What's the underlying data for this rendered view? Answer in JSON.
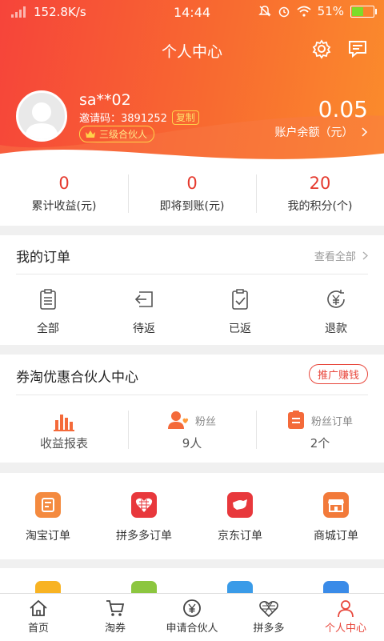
{
  "status_bar": {
    "network_speed": "152.8K/s",
    "time": "14:44",
    "battery": "51%"
  },
  "header": {
    "title": "个人中心"
  },
  "profile": {
    "username": "sa**02",
    "invite_label": "邀请码：3891252",
    "copy_label": "复制",
    "level": "三级合伙人",
    "balance": "0.05",
    "balance_label": "账户余额（元）"
  },
  "stats": [
    {
      "value": "0",
      "label": "累计收益(元)"
    },
    {
      "value": "0",
      "label": "即将到账(元)"
    },
    {
      "value": "20",
      "label": "我的积分(个)"
    }
  ],
  "orders": {
    "title": "我的订单",
    "view_all": "查看全部",
    "items": [
      {
        "label": "全部",
        "icon": "clipboard-list-icon"
      },
      {
        "label": "待返",
        "icon": "return-icon"
      },
      {
        "label": "已返",
        "icon": "clipboard-check-icon"
      },
      {
        "label": "退款",
        "icon": "yen-refund-icon"
      }
    ]
  },
  "partner": {
    "title": "券淘优惠合伙人中心",
    "promo_button": "推广赚钱",
    "report_label": "收益报表",
    "fans_label": "粉丝",
    "fans_count": "9人",
    "fan_orders_label": "粉丝订单",
    "fan_orders_count": "2个"
  },
  "tools": [
    {
      "label": "淘宝订单",
      "color": "#f48a3f"
    },
    {
      "label": "拼多多订单",
      "color": "#e8383c"
    },
    {
      "label": "京东订单",
      "color": "#e8383c"
    },
    {
      "label": "商城订单",
      "color": "#f27a3a"
    }
  ],
  "tools_row2_colors": [
    "#f8b323",
    "#8cc63f",
    "#3a9be8",
    "#3a8be8"
  ],
  "tabbar": [
    {
      "label": "首页",
      "icon": "home-icon"
    },
    {
      "label": "淘券",
      "icon": "cart-icon"
    },
    {
      "label": "申请合伙人",
      "icon": "yen-circle-icon"
    },
    {
      "label": "拼多多",
      "icon": "pinduoduo-icon"
    },
    {
      "label": "个人中心",
      "icon": "person-icon",
      "active": true
    }
  ],
  "colors": {
    "accent": "#e8473c",
    "header_start": "#f6443a",
    "header_end": "#fb8c2c"
  }
}
